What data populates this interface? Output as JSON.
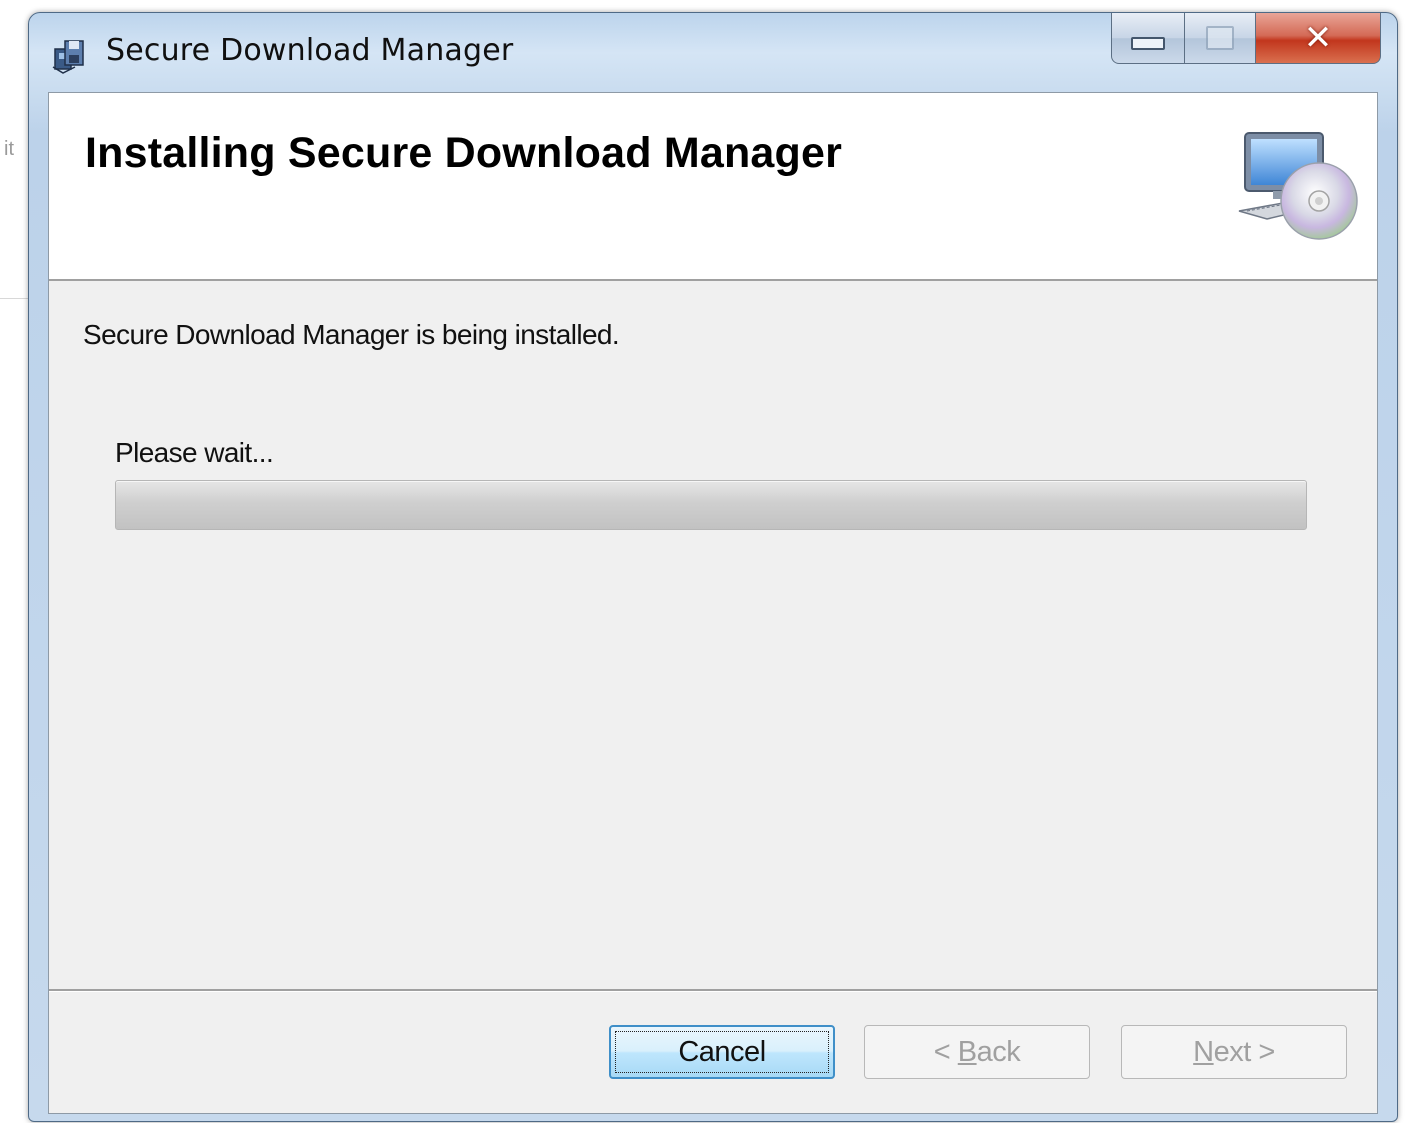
{
  "background": {
    "edge_text": "it"
  },
  "window": {
    "title": "Secure Download Manager",
    "caption_buttons": {
      "minimize_icon": "minimize-icon",
      "maximize_icon": "maximize-icon",
      "close_icon": "close-icon"
    }
  },
  "header": {
    "title": "Installing Secure Download Manager",
    "icon": "computer-disc-icon"
  },
  "body": {
    "status": "Secure Download Manager is being installed.",
    "wait_label": "Please wait...",
    "progress_fraction": 0.0
  },
  "buttons": {
    "cancel": "Cancel",
    "back": {
      "prefix": "< ",
      "mnemonic": "B",
      "rest": "ack"
    },
    "next": {
      "mnemonic": "N",
      "rest": "ext >"
    }
  },
  "colors": {
    "titlebar": "#c9dcef",
    "close_button": "#c2361d",
    "client_bg": "#f0f0f0",
    "header_bg": "#ffffff",
    "focused_button_border": "#3f8fc8"
  }
}
